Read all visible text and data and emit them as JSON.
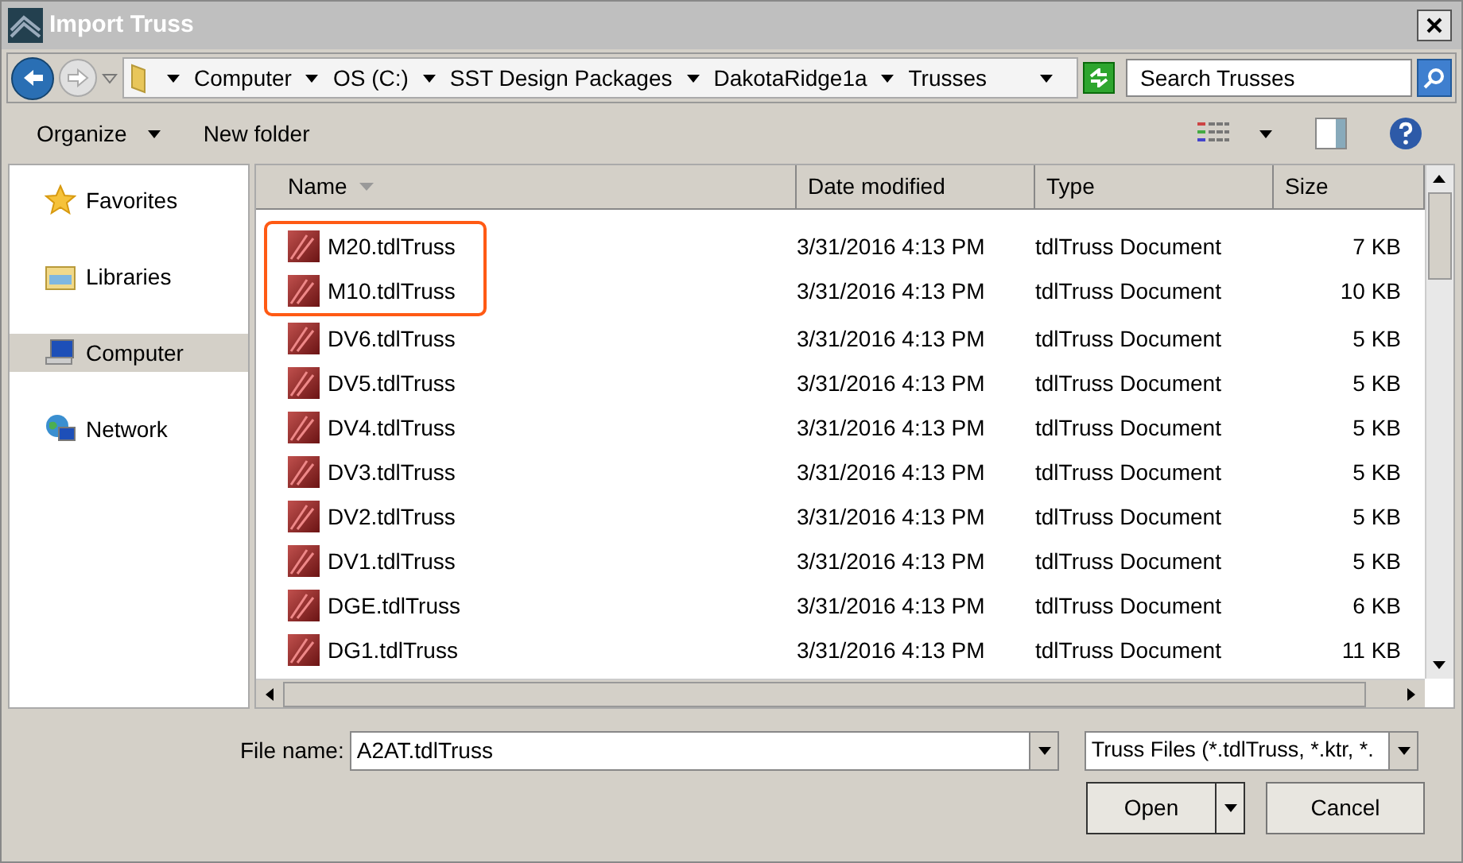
{
  "window": {
    "title": "Import Truss"
  },
  "address_bar": {
    "crumbs": [
      "Computer",
      "OS (C:)",
      "SST Design Packages",
      "DakotaRidge1a",
      "Trusses"
    ]
  },
  "search": {
    "placeholder": "Search Trusses"
  },
  "toolbar": {
    "organize": "Organize",
    "new_folder": "New folder"
  },
  "sidebar": {
    "items": [
      {
        "label": "Favorites",
        "kind": "star",
        "selected": false
      },
      {
        "label": "Libraries",
        "kind": "library",
        "selected": false
      },
      {
        "label": "Computer",
        "kind": "computer",
        "selected": true
      },
      {
        "label": "Network",
        "kind": "network",
        "selected": false
      }
    ]
  },
  "table": {
    "columns": [
      "Name",
      "Date modified",
      "Type",
      "Size"
    ],
    "rows": [
      {
        "name": "M20.tdlTruss",
        "date": "3/31/2016 4:13 PM",
        "type": "tdlTruss Document",
        "size": "7 KB",
        "highlighted": true
      },
      {
        "name": "M10.tdlTruss",
        "date": "3/31/2016 4:13 PM",
        "type": "tdlTruss Document",
        "size": "10 KB",
        "highlighted": true
      },
      {
        "name": "DV6.tdlTruss",
        "date": "3/31/2016 4:13 PM",
        "type": "tdlTruss Document",
        "size": "5 KB",
        "highlighted": false
      },
      {
        "name": "DV5.tdlTruss",
        "date": "3/31/2016 4:13 PM",
        "type": "tdlTruss Document",
        "size": "5 KB",
        "highlighted": false
      },
      {
        "name": "DV4.tdlTruss",
        "date": "3/31/2016 4:13 PM",
        "type": "tdlTruss Document",
        "size": "5 KB",
        "highlighted": false
      },
      {
        "name": "DV3.tdlTruss",
        "date": "3/31/2016 4:13 PM",
        "type": "tdlTruss Document",
        "size": "5 KB",
        "highlighted": false
      },
      {
        "name": "DV2.tdlTruss",
        "date": "3/31/2016 4:13 PM",
        "type": "tdlTruss Document",
        "size": "5 KB",
        "highlighted": false
      },
      {
        "name": "DV1.tdlTruss",
        "date": "3/31/2016 4:13 PM",
        "type": "tdlTruss Document",
        "size": "5 KB",
        "highlighted": false
      },
      {
        "name": "DGE.tdlTruss",
        "date": "3/31/2016 4:13 PM",
        "type": "tdlTruss Document",
        "size": "6 KB",
        "highlighted": false
      },
      {
        "name": "DG1.tdlTruss",
        "date": "3/31/2016 4:13 PM",
        "type": "tdlTruss Document",
        "size": "11 KB",
        "highlighted": false
      }
    ]
  },
  "file_name": {
    "label": "File name:",
    "value": "A2AT.tdlTruss"
  },
  "file_type": {
    "value": "Truss Files (*.tdlTruss, *.ktr, *."
  },
  "buttons": {
    "open": "Open",
    "cancel": "Cancel"
  }
}
